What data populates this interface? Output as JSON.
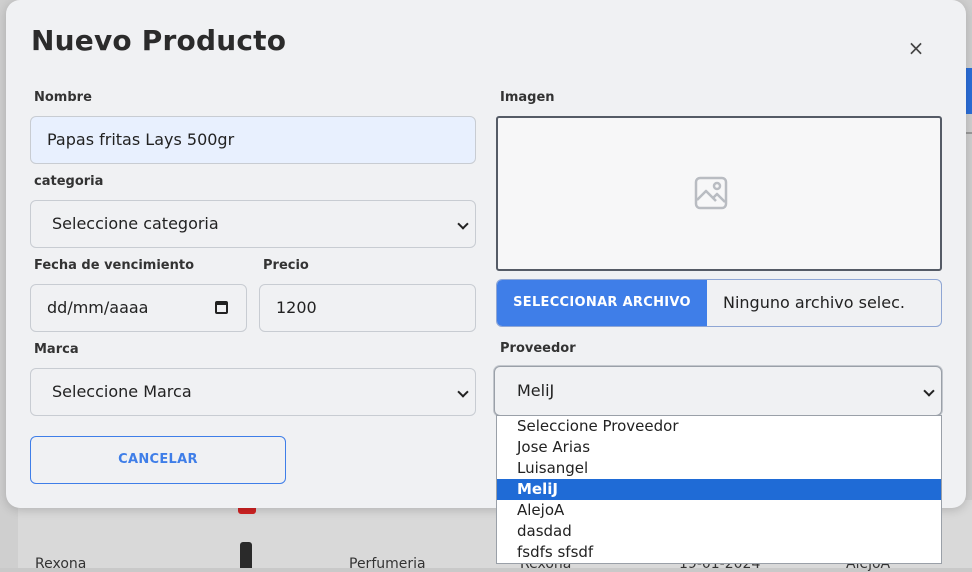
{
  "background": {
    "row": [
      "Rexona",
      "Perfumeria",
      "Rexona",
      "19-01-2024",
      "AlejoA"
    ]
  },
  "modal": {
    "title": "Nuevo Producto",
    "close_glyph": "×"
  },
  "form": {
    "nombre_label": "Nombre",
    "nombre_value": "Papas fritas Lays 500gr",
    "categoria_label": "categoria",
    "categoria_value": "Seleccione categoria",
    "fecha_label": "Fecha de vencimiento",
    "fecha_placeholder": "dd/mm/aaaa",
    "precio_label": "Precio",
    "precio_value": "1200",
    "marca_label": "Marca",
    "marca_value": "Seleccione Marca",
    "imagen_label": "Imagen",
    "file_button": "SELECCIONAR ARCHIVO",
    "file_status": "Ninguno archivo selec.",
    "proveedor_label": "Proveedor",
    "proveedor_value": "MeliJ",
    "cancel_button": "CANCELAR"
  },
  "proveedor_options": [
    "Seleccione Proveedor",
    "Jose Arias",
    "Luisangel",
    "MeliJ",
    "AlejoA",
    "dasdad",
    "fsdfs sfsdf"
  ],
  "proveedor_selected_index": 3,
  "icons": {
    "image_placeholder": "image-icon",
    "calendar": "calendar-icon",
    "chevron": "chevron-down-icon"
  },
  "colors": {
    "accent": "#3f7ee8",
    "selected_option": "#1f6bd6",
    "autofill": "#e8f0fe"
  }
}
